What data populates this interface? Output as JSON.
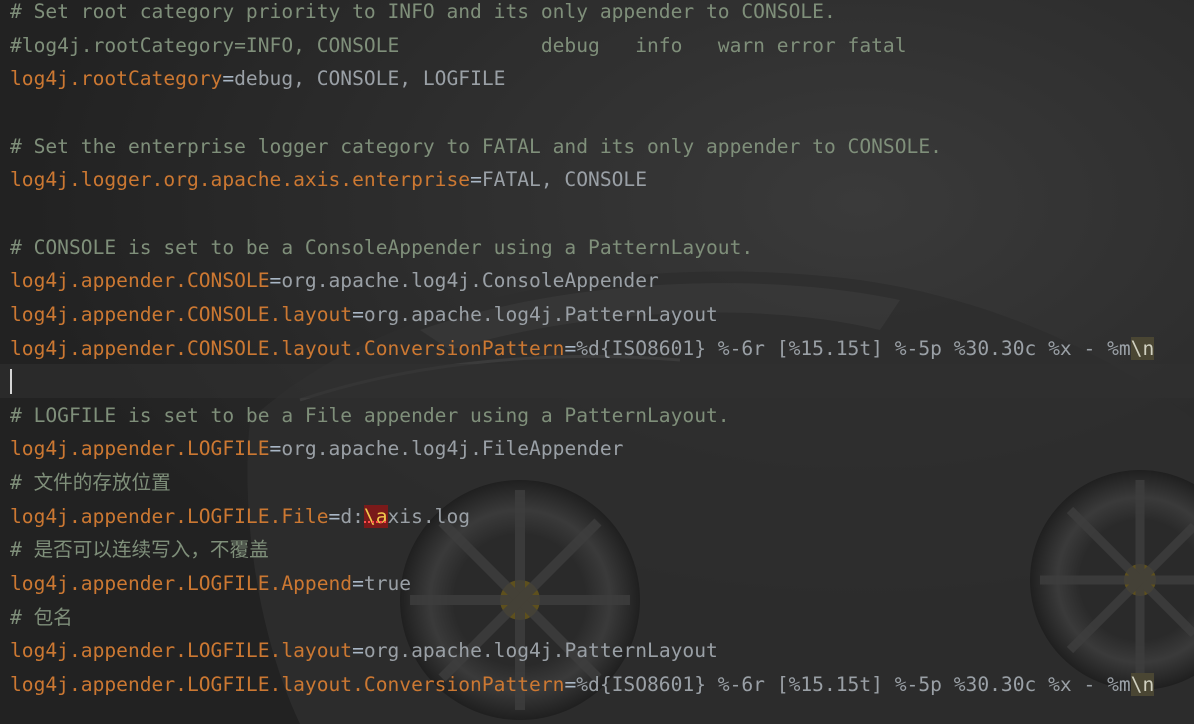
{
  "editor": {
    "lines": [
      {
        "kind": "comment",
        "text": "# Set root category priority to INFO and its only appender to CONSOLE."
      },
      {
        "kind": "comment",
        "text": "#log4j.rootCategory=INFO, CONSOLE            debug   info   warn error fatal"
      },
      {
        "kind": "prop",
        "key": "log4j.rootCategory",
        "eq": "=",
        "value": "debug, CONSOLE, LOGFILE"
      },
      {
        "kind": "blank",
        "text": ""
      },
      {
        "kind": "comment",
        "text": "# Set the enterprise logger category to FATAL and its only appender to CONSOLE."
      },
      {
        "kind": "prop",
        "key": "log4j.logger.org.apache.axis.enterprise",
        "eq": "=",
        "value": "FATAL, CONSOLE"
      },
      {
        "kind": "blank",
        "text": ""
      },
      {
        "kind": "comment",
        "text": "# CONSOLE is set to be a ConsoleAppender using a PatternLayout."
      },
      {
        "kind": "prop",
        "key": "log4j.appender.CONSOLE",
        "eq": "=",
        "value": "org.apache.log4j.ConsoleAppender"
      },
      {
        "kind": "prop",
        "key": "log4j.appender.CONSOLE.layout",
        "eq": "=",
        "value": "org.apache.log4j.PatternLayout"
      },
      {
        "kind": "prop-hl",
        "key": "log4j.appender.CONSOLE.layout.ConversionPattern",
        "eq": "=",
        "value": "%d{ISO8601} %-6r [%15.15t] %-5p %30.30c %x - %m",
        "hl": "\\n"
      },
      {
        "kind": "blank",
        "text": ""
      },
      {
        "kind": "comment",
        "text": "# LOGFILE is set to be a File appender using a PatternLayout."
      },
      {
        "kind": "prop",
        "key": "log4j.appender.LOGFILE",
        "eq": "=",
        "value": "org.apache.log4j.FileAppender"
      },
      {
        "kind": "comment",
        "text": "# 文件的存放位置"
      },
      {
        "kind": "prop-err",
        "key": "log4j.appender.LOGFILE.File",
        "eq": "=",
        "value": "d:",
        "err": "\\a",
        "rest": "xis.log"
      },
      {
        "kind": "comment",
        "text": "# 是否可以连续写入，不覆盖"
      },
      {
        "kind": "prop",
        "key": "log4j.appender.LOGFILE.Append",
        "eq": "=",
        "value": "true"
      },
      {
        "kind": "comment",
        "text": "# 包名"
      },
      {
        "kind": "prop",
        "key": "log4j.appender.LOGFILE.layout",
        "eq": "=",
        "value": "org.apache.log4j.PatternLayout"
      },
      {
        "kind": "prop-hl",
        "key": "log4j.appender.LOGFILE.layout.ConversionPattern",
        "eq": "=",
        "value": "%d{ISO8601} %-6r [%15.15t] %-5p %30.30c %x - %m",
        "hl": "\\n"
      }
    ]
  },
  "colors": {
    "comment": "#7f8f7a",
    "key": "#cc7832",
    "value": "#9aa0a6",
    "highlight_bg": "#4a4633",
    "error_bg": "#7a1a1a"
  }
}
